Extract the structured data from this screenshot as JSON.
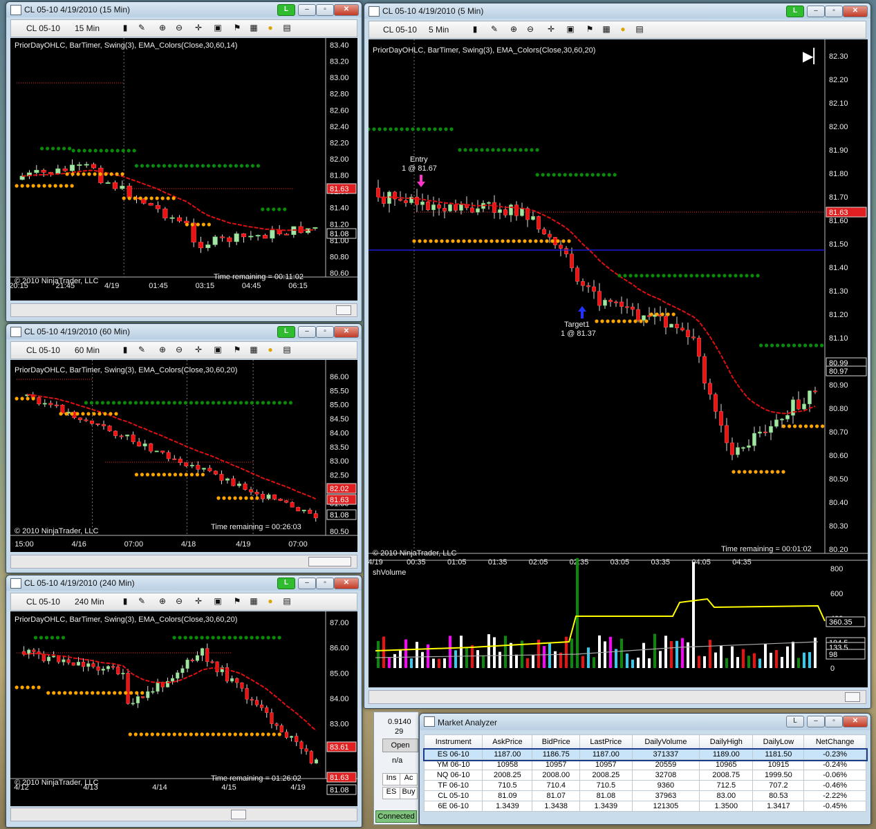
{
  "colors": {
    "bull": "#a6e3a6",
    "bear": "#ee1111",
    "ema": "#dd1111",
    "swing_high": "#0a8a0a",
    "swing_low": "#ffa500",
    "priorday": "#ff3333"
  },
  "win15": {
    "title": "CL 05-10  4/19/2010 (15 Min)",
    "instrument": "CL 05-10",
    "interval": "15 Min",
    "indicators": "PriorDayOHLC, BarTimer, Swing(3), EMA_Colors(Close,30,60,14)",
    "copyright": "© 2010 NinjaTrader, LLC",
    "time_remaining": "Time remaining = 00:11:02",
    "yticks": [
      "83.40",
      "83.20",
      "83.00",
      "82.80",
      "82.60",
      "82.40",
      "82.20",
      "82.00",
      "81.80",
      "81.60",
      "81.40",
      "81.20",
      "81.00",
      "80.80",
      "80.60"
    ],
    "xticks": [
      "20:15",
      "21:45",
      "4/19",
      "01:45",
      "03:15",
      "04:45",
      "06:15"
    ],
    "price_tags": [
      {
        "v": "81.63",
        "color": "#e02020"
      },
      {
        "v": "81.08",
        "color": "#000000"
      }
    ]
  },
  "win60": {
    "title": "CL 05-10  4/19/2010 (60 Min)",
    "instrument": "CL 05-10",
    "interval": "60 Min",
    "indicators": "PriorDayOHLC, BarTimer, Swing(3), EMA_Colors(Close,30,60,20)",
    "copyright": "© 2010 NinjaTrader, LLC",
    "time_remaining": "Time remaining = 00:26:03",
    "yticks": [
      "86.00",
      "85.50",
      "85.00",
      "84.50",
      "84.00",
      "83.50",
      "83.00",
      "82.50",
      "82.00",
      "81.50",
      "81.00",
      "80.50"
    ],
    "xticks": [
      "15:00",
      "4/16",
      "07:00",
      "4/18",
      "4/19",
      "07:00"
    ],
    "price_tags": [
      {
        "v": "82.02",
        "color": "#e02020"
      },
      {
        "v": "81.63",
        "color": "#e02020"
      },
      {
        "v": "81.08",
        "color": "#000000"
      }
    ]
  },
  "win240": {
    "title": "CL 05-10  4/19/2010 (240 Min)",
    "instrument": "CL 05-10",
    "interval": "240 Min",
    "indicators": "PriorDayOHLC, BarTimer, Swing(3), EMA_Colors(Close,30,60,20)",
    "copyright": "© 2010 NinjaTrader, LLC",
    "time_remaining": "Time remaining = 01:26:02",
    "yticks": [
      "87.00",
      "86.00",
      "85.00",
      "84.00",
      "83.00",
      "82.00",
      "81.00"
    ],
    "xticks": [
      "4/12",
      "4/13",
      "4/14",
      "4/15",
      "4/19"
    ],
    "price_tags": [
      {
        "v": "83.61",
        "color": "#e02020"
      },
      {
        "v": "81.63",
        "color": "#e02020"
      },
      {
        "v": "81.08",
        "color": "#000000"
      }
    ]
  },
  "win5": {
    "title": "CL 05-10  4/19/2010 (5 Min)",
    "instrument": "CL 05-10",
    "interval": "5 Min",
    "indicators": "PriorDayOHLC, BarTimer, Swing(3), EMA_Colors(Close,30,60,20)",
    "copyright": "© 2010 NinjaTrader, LLC",
    "time_remaining": "Time remaining = 00:01:02",
    "yticks": [
      "82.30",
      "82.20",
      "82.10",
      "82.00",
      "81.90",
      "81.80",
      "81.70",
      "81.60",
      "81.50",
      "81.40",
      "81.30",
      "81.20",
      "81.10",
      "81.00",
      "80.90",
      "80.80",
      "80.70",
      "80.60",
      "80.50",
      "80.40",
      "80.30",
      "80.20"
    ],
    "xticks": [
      "4/19",
      "00:35",
      "01:05",
      "01:35",
      "02:05",
      "02:35",
      "03:05",
      "03:35",
      "04:05",
      "04:35"
    ],
    "price_tags": [
      {
        "v": "81.63",
        "color": "#e02020"
      },
      {
        "v": "80.99",
        "color": "#000000"
      },
      {
        "v": "80.97",
        "color": "#000000"
      }
    ],
    "entry_label": "Entry",
    "entry_detail": "1 @ 81.67",
    "target_label": "Target1",
    "target_detail": "1 @ 81.37",
    "volume_panel": "shVolume",
    "vol_yticks": [
      "800",
      "600",
      "400",
      "200",
      "0"
    ],
    "vol_tags": [
      {
        "v": "360.35",
        "color": "#000000"
      },
      {
        "v": "194.5",
        "color": "#000000"
      },
      {
        "v": "133.5",
        "color": "#000000"
      },
      {
        "v": "98",
        "color": "#000000"
      }
    ]
  },
  "side_panel": {
    "value1": "0.9140",
    "value2": "29",
    "open_btn": "Open",
    "na": "n/a",
    "ins": "Ins",
    "ac": "Ac",
    "es": "ES",
    "buy": "Buy",
    "connected": "Connected"
  },
  "market_analyzer": {
    "title": "Market Analyzer",
    "columns": [
      "Instrument",
      "AskPrice",
      "BidPrice",
      "LastPrice",
      "DailyVolume",
      "DailyHigh",
      "DailyLow",
      "NetChange"
    ],
    "rows": [
      [
        "ES 06-10",
        "1187.00",
        "1186.75",
        "1187.00",
        "371337",
        "1189.00",
        "1181.50",
        "-0.23%"
      ],
      [
        "YM 06-10",
        "10958",
        "10957",
        "10957",
        "20559",
        "10965",
        "10915",
        "-0.24%"
      ],
      [
        "NQ 06-10",
        "2008.25",
        "2008.00",
        "2008.25",
        "32708",
        "2008.75",
        "1999.50",
        "-0.06%"
      ],
      [
        "TF 06-10",
        "710.5",
        "710.4",
        "710.5",
        "9360",
        "712.5",
        "707.2",
        "-0.46%"
      ],
      [
        "CL 05-10",
        "81.09",
        "81.07",
        "81.08",
        "37963",
        "83.00",
        "80.53",
        "-2.22%"
      ],
      [
        "6E 06-10",
        "1.3439",
        "1.3438",
        "1.3439",
        "121305",
        "1.3500",
        "1.3417",
        "-0.45%"
      ]
    ]
  }
}
